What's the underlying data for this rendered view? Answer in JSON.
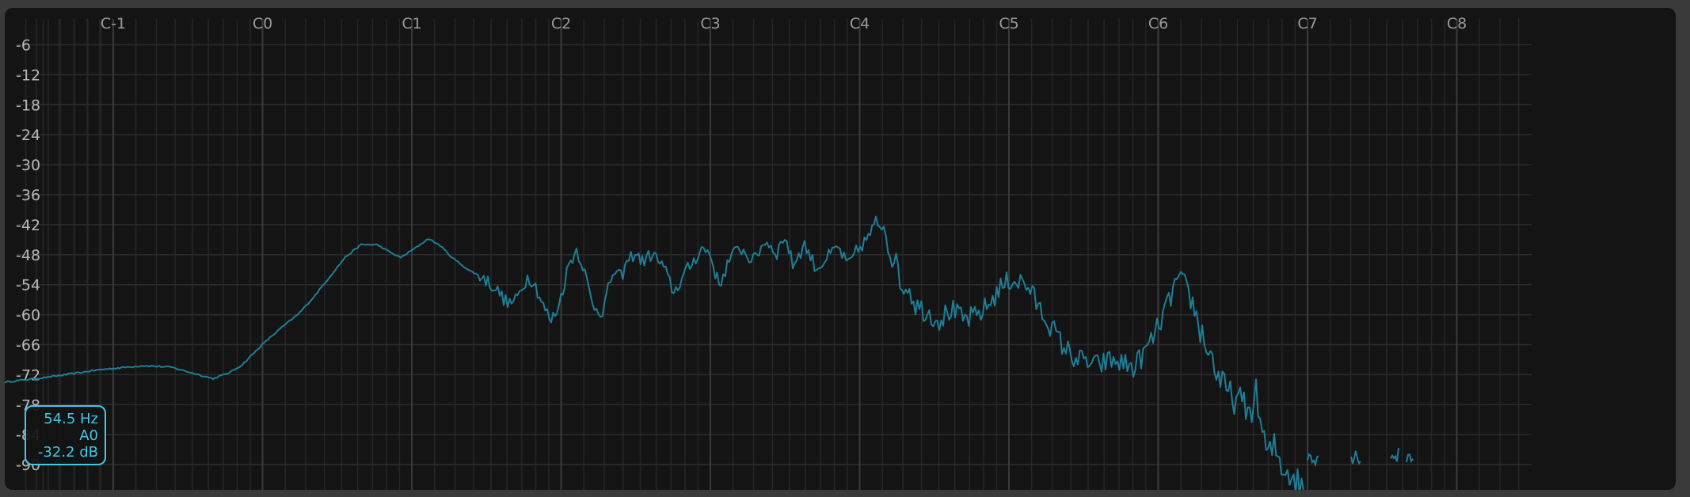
{
  "spectrum": {
    "note_labels": [
      "C-1",
      "C0",
      "C1",
      "C2",
      "C3",
      "C4",
      "C5",
      "C6",
      "C7",
      "C8"
    ],
    "db_labels": [
      "-6",
      "-12",
      "-18",
      "-24",
      "-30",
      "-36",
      "-42",
      "-48",
      "-54",
      "-60",
      "-66",
      "-72",
      "-78",
      "-84",
      "-90"
    ],
    "trace_color": "#1f7e96",
    "accent_color": "#3fc8ea",
    "curve": [
      [
        0,
        -73.5
      ],
      [
        60,
        -72.4
      ],
      [
        120,
        -71.0
      ],
      [
        175,
        -70.2
      ],
      [
        210,
        -70.5
      ],
      [
        240,
        -71.8
      ],
      [
        263,
        -72.8
      ],
      [
        285,
        -71.5
      ],
      [
        300,
        -70
      ],
      [
        325,
        -66
      ],
      [
        350,
        -62.5
      ],
      [
        370,
        -60
      ],
      [
        390,
        -56.5
      ],
      [
        410,
        -52.5
      ],
      [
        430,
        -48.5
      ],
      [
        450,
        -46
      ],
      [
        470,
        -46
      ],
      [
        490,
        -47.8
      ],
      [
        500,
        -48.6
      ],
      [
        520,
        -46.5
      ],
      [
        535,
        -44.8
      ],
      [
        550,
        -46.2
      ],
      [
        565,
        -48.6
      ],
      [
        585,
        -51
      ],
      [
        605,
        -52.7
      ],
      [
        620,
        -54.8
      ],
      [
        635,
        -57.8
      ],
      [
        645,
        -57.2
      ],
      [
        660,
        -52.5
      ],
      [
        668,
        -53.3
      ],
      [
        680,
        -58.3
      ],
      [
        690,
        -61.3
      ],
      [
        700,
        -58
      ],
      [
        712,
        -50
      ],
      [
        722,
        -47
      ],
      [
        730,
        -50
      ],
      [
        742,
        -58
      ],
      [
        755,
        -59.5
      ],
      [
        762,
        -55
      ],
      [
        768,
        -51.5
      ],
      [
        778,
        -52.5
      ],
      [
        788,
        -49
      ],
      [
        796,
        -47.6
      ],
      [
        805,
        -49.4
      ],
      [
        818,
        -47.8
      ],
      [
        832,
        -50.6
      ],
      [
        845,
        -55.6
      ],
      [
        860,
        -51.5
      ],
      [
        880,
        -46.8
      ],
      [
        890,
        -47.6
      ],
      [
        902,
        -54.2
      ],
      [
        915,
        -49
      ],
      [
        928,
        -46.5
      ],
      [
        945,
        -49.3
      ],
      [
        960,
        -45.2
      ],
      [
        975,
        -47.6
      ],
      [
        985,
        -44.2
      ],
      [
        995,
        -50
      ],
      [
        1010,
        -46
      ],
      [
        1025,
        -50.8
      ],
      [
        1038,
        -48.7
      ],
      [
        1052,
        -46.5
      ],
      [
        1065,
        -50.2
      ],
      [
        1075,
        -47.5
      ],
      [
        1088,
        -45
      ],
      [
        1100,
        -42
      ],
      [
        1110,
        -41.6
      ],
      [
        1118,
        -47.5
      ],
      [
        1128,
        -50.7
      ],
      [
        1133,
        -55
      ],
      [
        1140,
        -54
      ],
      [
        1150,
        -58
      ],
      [
        1165,
        -59.5
      ],
      [
        1180,
        -61
      ],
      [
        1195,
        -59
      ],
      [
        1210,
        -61
      ],
      [
        1225,
        -60.5
      ],
      [
        1240,
        -58.5
      ],
      [
        1255,
        -55
      ],
      [
        1270,
        -53
      ],
      [
        1285,
        -53.5
      ],
      [
        1295,
        -55
      ],
      [
        1305,
        -58.5
      ],
      [
        1320,
        -62
      ],
      [
        1335,
        -66
      ],
      [
        1350,
        -68.5
      ],
      [
        1365,
        -69.5
      ],
      [
        1380,
        -70.2
      ],
      [
        1395,
        -69.2
      ],
      [
        1410,
        -69.6
      ],
      [
        1425,
        -70.6
      ],
      [
        1440,
        -67.5
      ],
      [
        1455,
        -63
      ],
      [
        1470,
        -57.5
      ],
      [
        1480,
        -53
      ],
      [
        1490,
        -54
      ],
      [
        1500,
        -58
      ],
      [
        1512,
        -64
      ],
      [
        1525,
        -69
      ],
      [
        1535,
        -73.5
      ],
      [
        1545,
        -76
      ],
      [
        1560,
        -77.5
      ],
      [
        1572,
        -79.5
      ],
      [
        1580,
        -76
      ],
      [
        1588,
        -83.5
      ],
      [
        1595,
        -88.5
      ],
      [
        1603,
        -86.5
      ],
      [
        1612,
        -90
      ],
      [
        1625,
        -92
      ],
      [
        1640,
        -95
      ]
    ]
  },
  "readout": {
    "frequency": "54.5 Hz",
    "note": "A0",
    "level": "-32.2 dB"
  }
}
